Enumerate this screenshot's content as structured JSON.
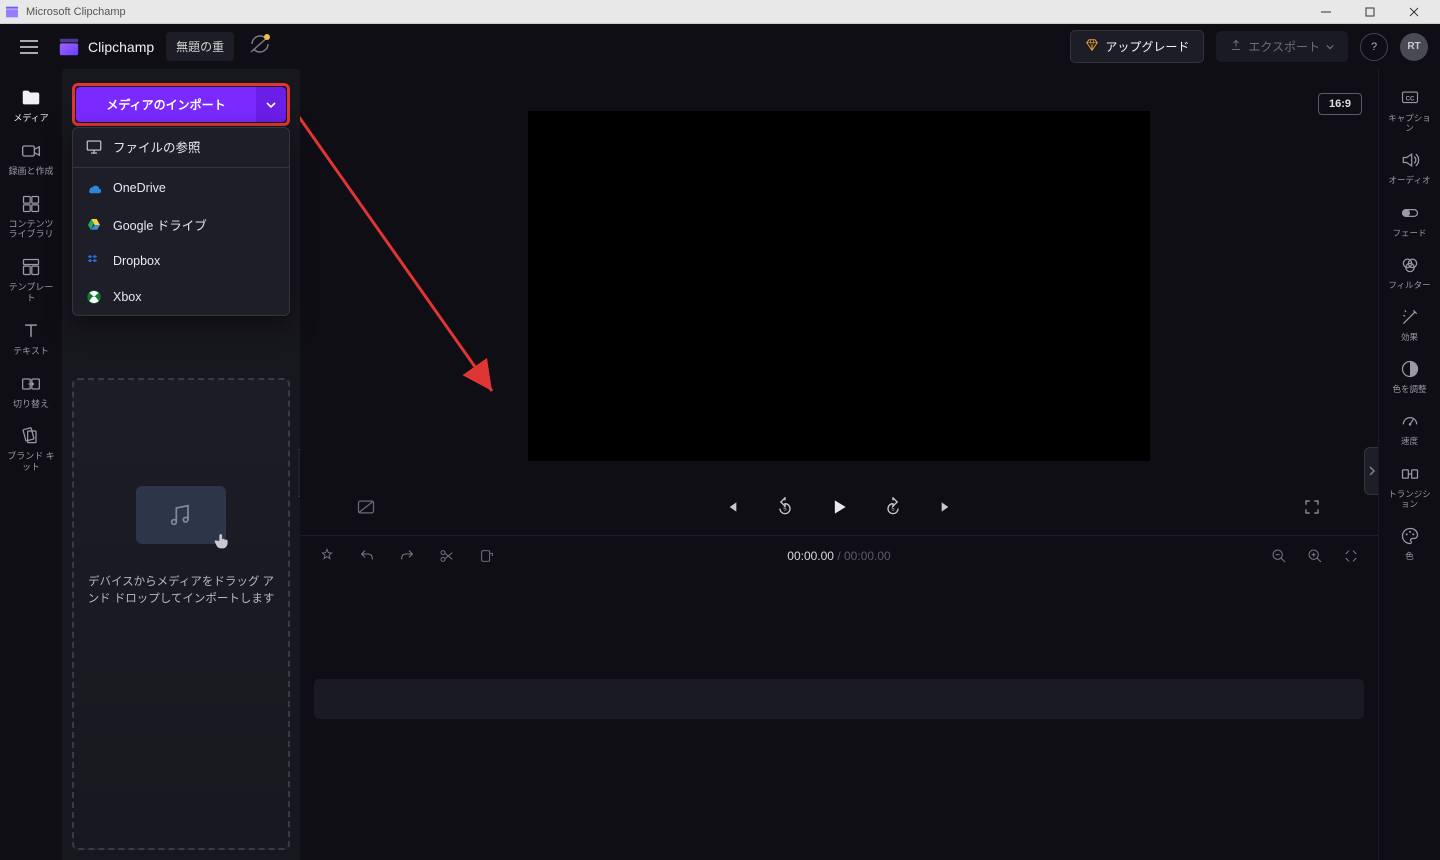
{
  "window": {
    "title": "Microsoft Clipchamp"
  },
  "header": {
    "brand": "Clipchamp",
    "project_title": "無題の重",
    "upgrade_label": "アップグレード",
    "export_label": "エクスポート",
    "avatar_initials": "RT"
  },
  "left_nav": [
    {
      "id": "media",
      "label": "メディア",
      "active": true
    },
    {
      "id": "record",
      "label": "録画と作成"
    },
    {
      "id": "library",
      "label": "コンテンツ\nライブラリ"
    },
    {
      "id": "templates",
      "label": "テンプレー\nト"
    },
    {
      "id": "text",
      "label": "テキスト"
    },
    {
      "id": "transitions",
      "label": "切り替え"
    },
    {
      "id": "brandkit",
      "label": "ブランド キ\nット"
    }
  ],
  "import": {
    "button_label": "メディアのインポート",
    "menu": [
      {
        "id": "browse",
        "label": "ファイルの参照"
      },
      {
        "id": "onedrive",
        "label": "OneDrive"
      },
      {
        "id": "gdrive",
        "label": "Google ドライブ"
      },
      {
        "id": "dropbox",
        "label": "Dropbox"
      },
      {
        "id": "xbox",
        "label": "Xbox"
      }
    ]
  },
  "dropzone": {
    "text": "デバイスからメディアをドラッグ アンド ドロップしてインポートします"
  },
  "preview": {
    "aspect_label": "16:9"
  },
  "timeline": {
    "current": "00:00.00",
    "duration": "00:00.00"
  },
  "right_nav": [
    {
      "id": "captions",
      "label": "キャプショ\nン"
    },
    {
      "id": "audio",
      "label": "オーディオ"
    },
    {
      "id": "fade",
      "label": "フェード"
    },
    {
      "id": "filters",
      "label": "フィルター"
    },
    {
      "id": "effects",
      "label": "効果"
    },
    {
      "id": "adjust",
      "label": "色を調整"
    },
    {
      "id": "speed",
      "label": "速度"
    },
    {
      "id": "transition",
      "label": "トランジシ\nョン"
    },
    {
      "id": "color",
      "label": "色"
    }
  ],
  "colors": {
    "accent": "#7a2aff",
    "highlight": "#e03535"
  }
}
